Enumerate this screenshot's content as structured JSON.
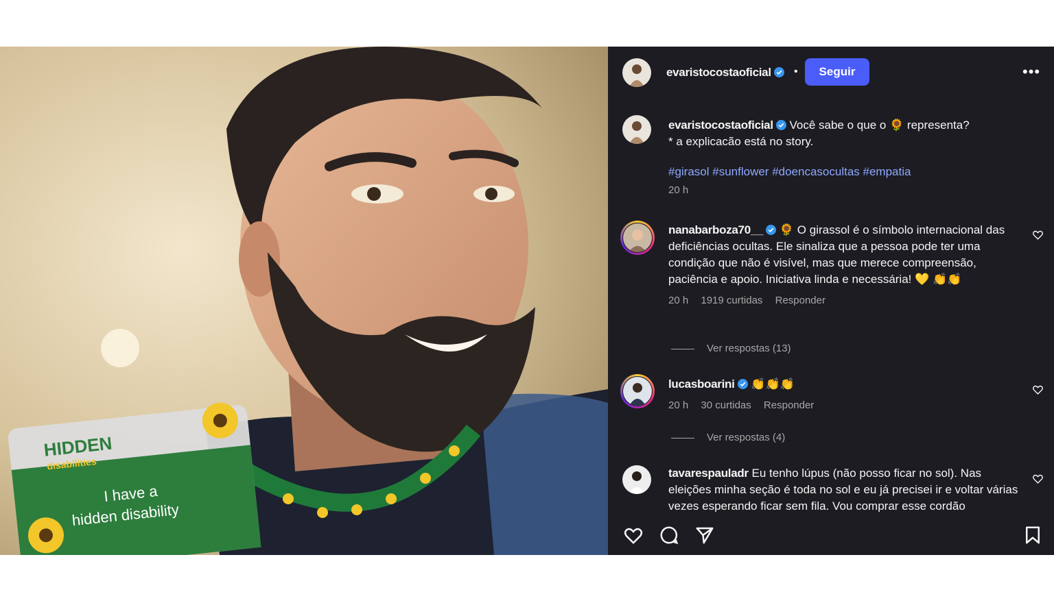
{
  "post": {
    "username": "evaristocostaoficial",
    "follow_label": "Seguir",
    "more_label": "•••",
    "header_dot": "•"
  },
  "photo": {
    "badge_title": "HIDDEN",
    "badge_sub": "disabilities",
    "badge_line1": "I have a",
    "badge_line2": "hidden disability"
  },
  "caption": {
    "username": "evaristocostaoficial",
    "text_part1": "Você sabe o que o 🌻 representa?",
    "text_line2": "* a explicacão está no story.",
    "hashtags": "#girasol #sunflower #doencasocultas #empatia",
    "time": "20 h"
  },
  "comments": [
    {
      "username": "nanabarboza70__",
      "verified": true,
      "text": "🌻 O girassol é o símbolo internacional das deficiências ocultas. Ele sinaliza que a pessoa pode ter uma condição que não é visível, mas que merece compreensão, paciência e apoio. Iniciativa linda e necessária! 💛 👏👏",
      "time": "20 h",
      "likes": "1919 curtidas",
      "reply": "Responder",
      "view_replies": "Ver respostas (13)"
    },
    {
      "username": "lucasboarini",
      "verified": true,
      "text": "👏👏👏",
      "time": "20 h",
      "likes": "30 curtidas",
      "reply": "Responder",
      "view_replies": "Ver respostas (4)"
    },
    {
      "username": "tavarespauladr",
      "verified": false,
      "text": "Eu tenho lúpus (não posso ficar no sol). Nas eleições minha seção é toda no sol e eu já precisei ir e voltar várias vezes esperando ficar sem fila. Vou comprar esse cordão"
    }
  ],
  "colors": {
    "panel_bg": "#1c1c22",
    "follow_bg": "#4a5df9",
    "hashtag": "#8fa8ff",
    "meta": "#a8a8a8",
    "verified": "#3897f0"
  },
  "icons": {
    "like": "heart-icon",
    "comment": "comment-icon",
    "share": "send-icon",
    "save": "bookmark-icon",
    "verified": "verified-badge-icon"
  }
}
